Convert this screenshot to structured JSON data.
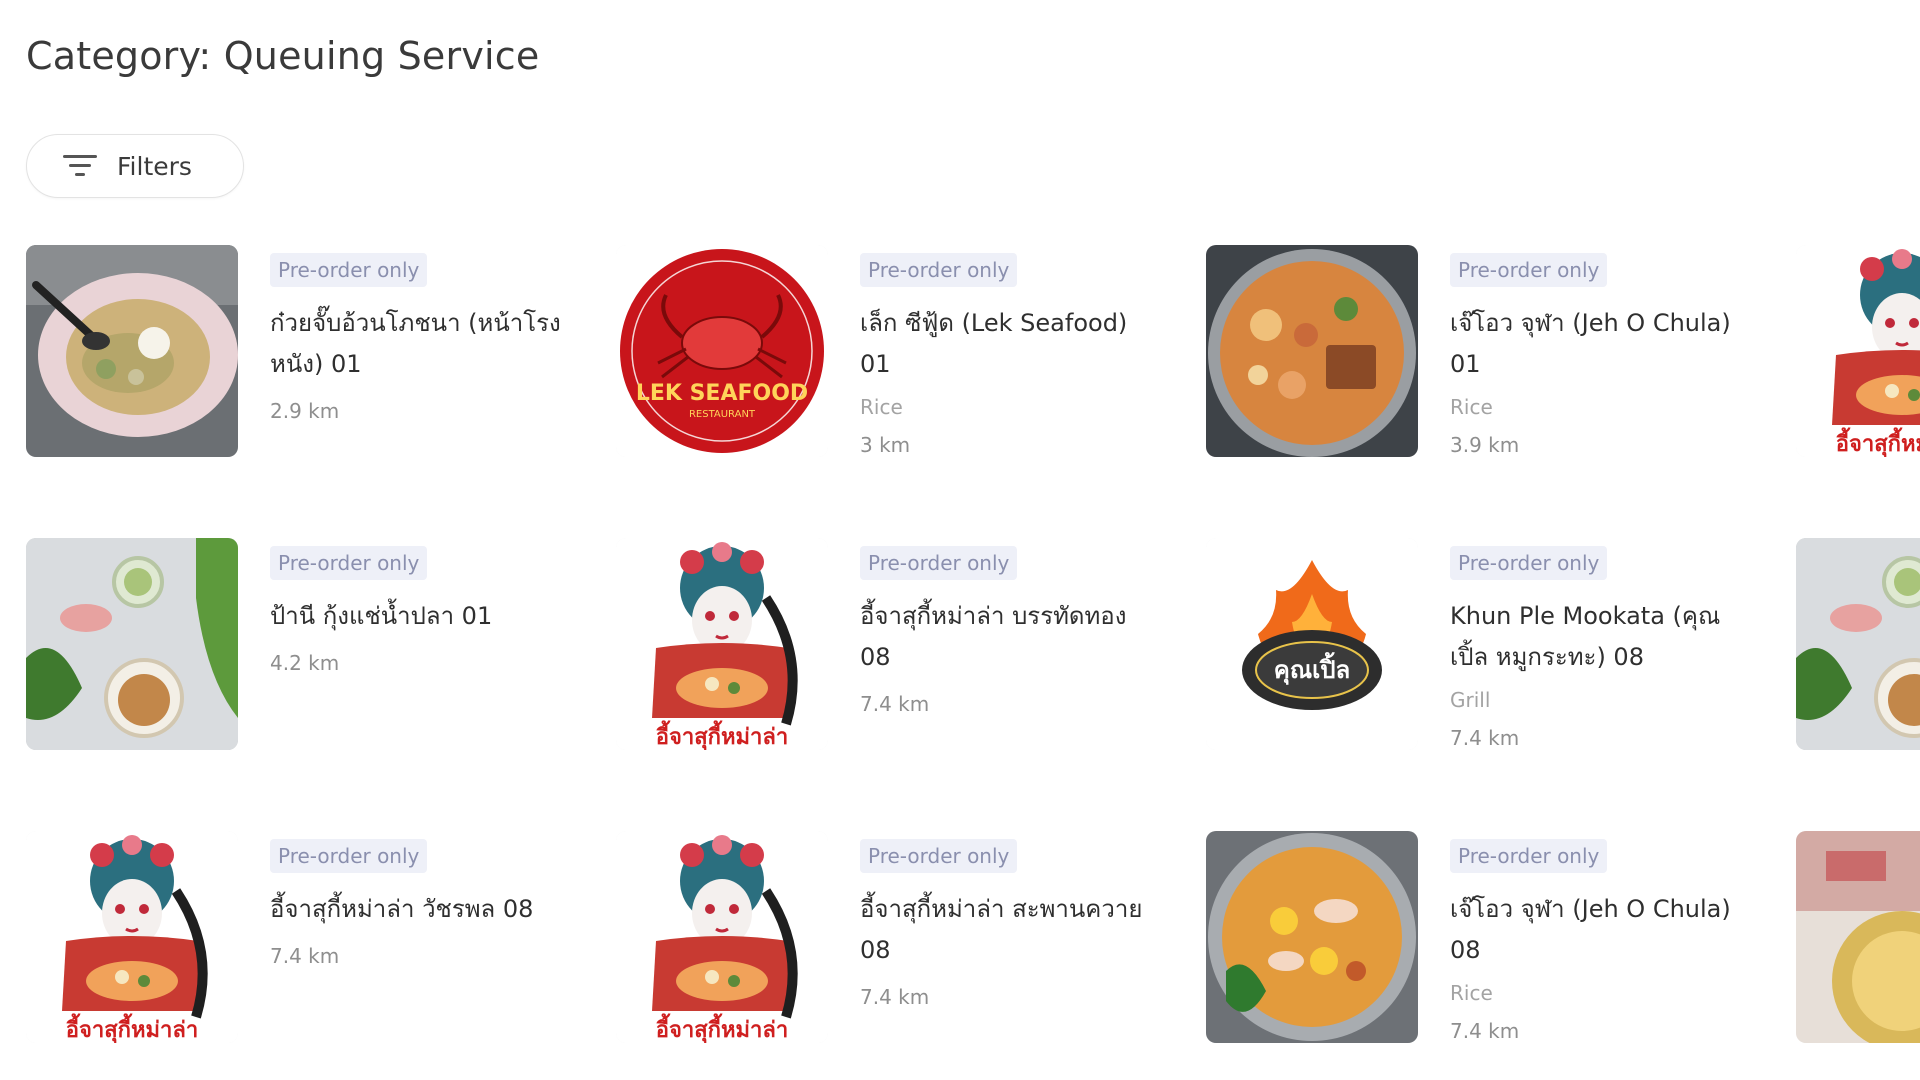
{
  "page": {
    "title": "Category: Queuing Service",
    "filters_label": "Filters"
  },
  "restaurants": [
    {
      "badge": "Pre-order only",
      "name": "ก๋วยจั๊บอ้วนโภชนา (หน้าโรงหนัง) 01",
      "cuisine": "",
      "distance": "2.9 km",
      "image": "noodle-soup-bowl"
    },
    {
      "badge": "Pre-order only",
      "name": "เล็ก ซีฟู้ด (Lek Seafood) 01",
      "cuisine": "Rice",
      "distance": "3 km",
      "image": "lek-seafood-logo"
    },
    {
      "badge": "Pre-order only",
      "name": "เจ๊โอว จุฬา (Jeh O Chula) 01",
      "cuisine": "Rice",
      "distance": "3.9 km",
      "image": "hot-pot"
    },
    {
      "badge": "Pre-order only",
      "name": "ป้านี กุ้งแช่น้ำปลา 01",
      "cuisine": "",
      "distance": "4.2 km",
      "image": "shrimp-platter"
    },
    {
      "badge": "Pre-order only",
      "name": "อี้จาสุกี้หม่าล่า บรรทัดทอง 08",
      "cuisine": "",
      "distance": "7.4 km",
      "image": "opera-girl-logo"
    },
    {
      "badge": "Pre-order only",
      "name": "Khun Ple Mookata (คุณเปิ้ล หมูกระทะ) 08",
      "cuisine": "Grill",
      "distance": "7.4 km",
      "image": "khun-ple-fire-logo"
    },
    {
      "badge": "Pre-order only",
      "name": "อี้จาสุกี้หม่าล่า วัชรพล 08",
      "cuisine": "",
      "distance": "7.4 km",
      "image": "opera-girl-logo"
    },
    {
      "badge": "Pre-order only",
      "name": "อี้จาสุกี้หม่าล่า สะพานควาย 08",
      "cuisine": "",
      "distance": "7.4 km",
      "image": "opera-girl-logo"
    },
    {
      "badge": "Pre-order only",
      "name": "เจ๊โอว จุฬา (Jeh O Chula) 08",
      "cuisine": "Rice",
      "distance": "7.4 km",
      "image": "tom-yum-pot"
    }
  ],
  "logo_text": {
    "lek": "LEK SEAFOOD",
    "lek_sub": "RESTAURANT",
    "opera": "อี้จาสุกี้หม่าล่า",
    "khunple": "คุณเปิ้ล"
  }
}
